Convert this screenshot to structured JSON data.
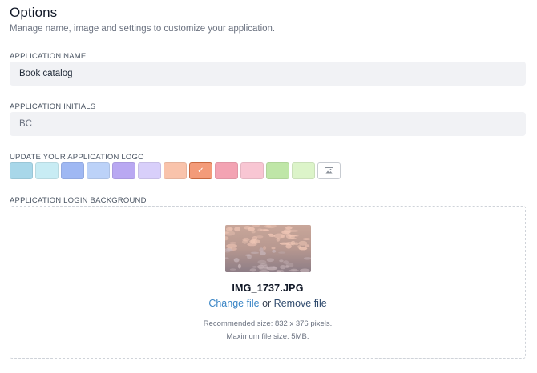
{
  "header": {
    "title": "Options",
    "subtitle": "Manage name, image and settings to customize your application."
  },
  "app_name": {
    "label": "APPLICATION NAME",
    "value": "Book catalog"
  },
  "app_initials": {
    "label": "APPLICATION INITIALS",
    "value": "BC"
  },
  "logo": {
    "label": "UPDATE YOUR APPLICATION LOGO",
    "swatches": [
      {
        "color": "#a8d7e9"
      },
      {
        "color": "#c8ecf4"
      },
      {
        "color": "#9fb8f3"
      },
      {
        "color": "#bcd2f8"
      },
      {
        "color": "#b9a8f2"
      },
      {
        "color": "#d8cffa"
      },
      {
        "color": "#f9c3ab"
      },
      {
        "color": "#f39b79",
        "selected": true
      },
      {
        "color": "#f3a3b3"
      },
      {
        "color": "#f8c6d3"
      },
      {
        "color": "#bfe6a7"
      },
      {
        "color": "#dcf4c9"
      }
    ],
    "check_glyph": "✓",
    "image_icon": "image-icon"
  },
  "background": {
    "label": "APPLICATION LOGIN BACKGROUND",
    "filename": "IMG_1737.JPG",
    "change_label": "Change file",
    "or_label": "or",
    "remove_label": "Remove file",
    "hint_size": "Recommended size: 832 x 376 pixels.",
    "hint_max": "Maximum file size: 5MB."
  }
}
